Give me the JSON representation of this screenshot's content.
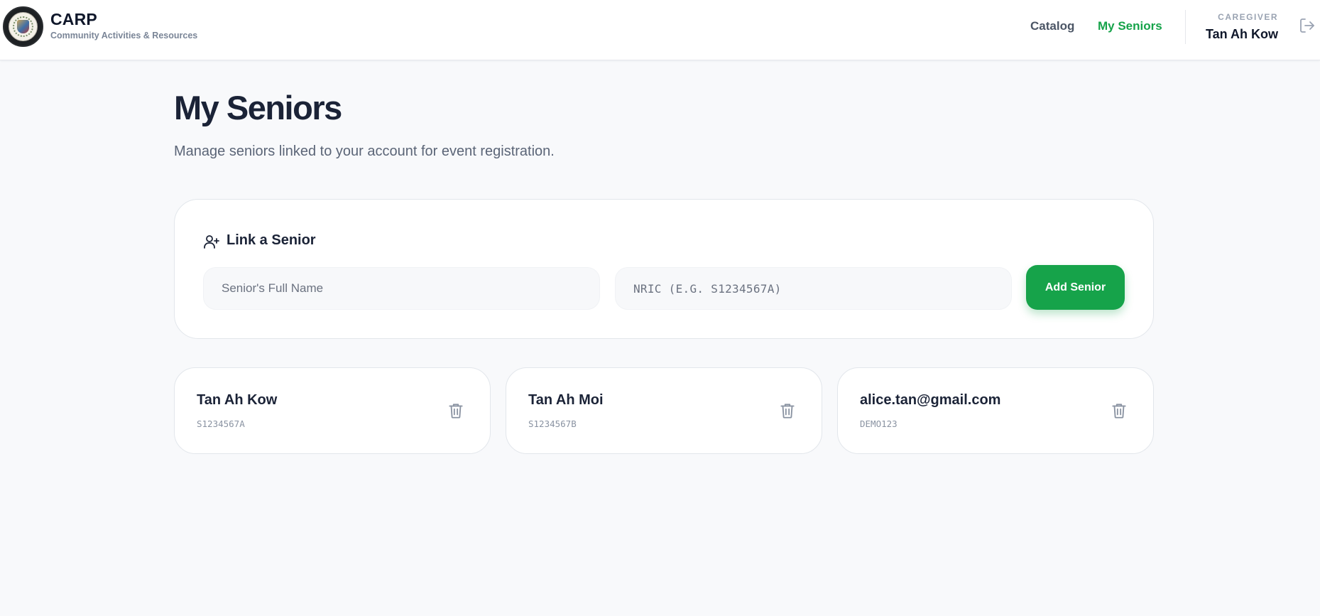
{
  "brand": {
    "title": "CARP",
    "subtitle": "Community Activities & Resources",
    "logo_icon": "emblem-seal-icon"
  },
  "nav": {
    "items": [
      {
        "label": "Catalog",
        "active": false
      },
      {
        "label": "My Seniors",
        "active": true
      }
    ],
    "active_color": "#16a34a"
  },
  "user": {
    "role": "CAREGIVER",
    "name": "Tan Ah Kow",
    "logout_icon": "logout-icon"
  },
  "page": {
    "title": "My Seniors",
    "subtitle": "Manage seniors linked to your account for event registration."
  },
  "link_form": {
    "title": "Link a Senior",
    "icon": "user-plus-icon",
    "name_field": {
      "value": "",
      "placeholder": "Senior's Full Name"
    },
    "nric_field": {
      "value": "",
      "placeholder": "NRIC (E.G. S1234567A)"
    },
    "submit_label": "Add Senior",
    "accent_color": "#16a34a"
  },
  "seniors": [
    {
      "name": "Tan Ah Kow",
      "id": "S1234567A",
      "action_icon": "trash-icon"
    },
    {
      "name": "Tan Ah Moi",
      "id": "S1234567B",
      "action_icon": "trash-icon"
    },
    {
      "name": "alice.tan@gmail.com",
      "id": "DEMO123",
      "action_icon": "trash-icon"
    }
  ]
}
